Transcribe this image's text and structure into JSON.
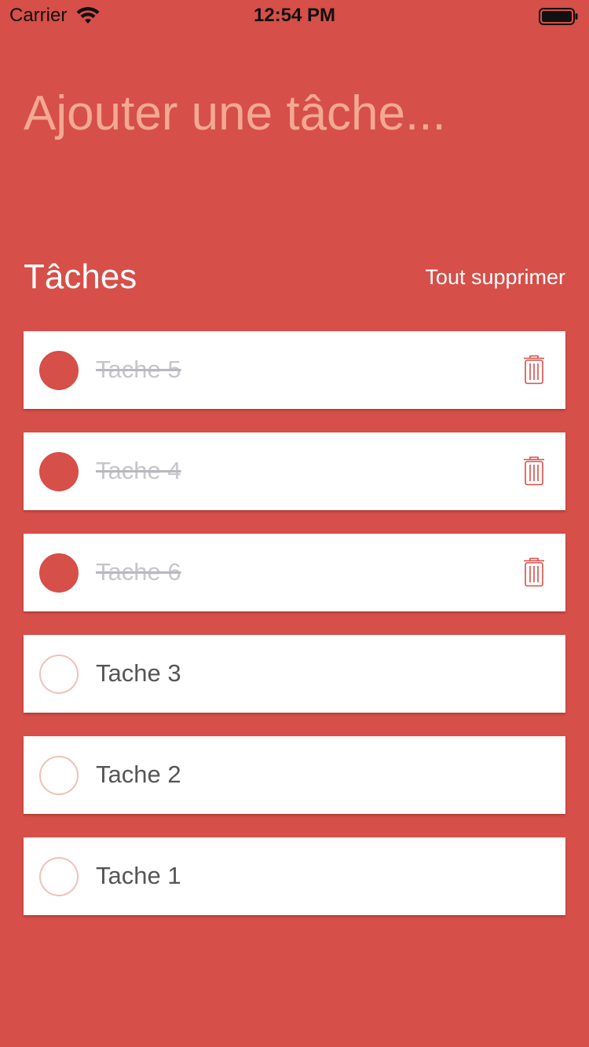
{
  "status_bar": {
    "carrier": "Carrier",
    "time": "12:54 PM",
    "wifi_icon": "wifi-icon",
    "battery_icon": "battery-icon"
  },
  "input": {
    "placeholder": "Ajouter une tâche...",
    "value": ""
  },
  "header": {
    "title": "Tâches",
    "clear_all_label": "Tout supprimer"
  },
  "tasks": [
    {
      "label": "Tache 5",
      "done": true
    },
    {
      "label": "Tache 4",
      "done": true
    },
    {
      "label": "Tache 6",
      "done": true
    },
    {
      "label": "Tache 3",
      "done": false
    },
    {
      "label": "Tache 2",
      "done": false
    },
    {
      "label": "Tache 1",
      "done": false
    }
  ],
  "colors": {
    "accent": "#D64F48",
    "placeholder": "#F3A891",
    "done_text": "#C6C6CB",
    "todo_text": "#555555",
    "todo_ring": "#F0C0BA"
  },
  "icons": {
    "delete": "trash-icon"
  }
}
